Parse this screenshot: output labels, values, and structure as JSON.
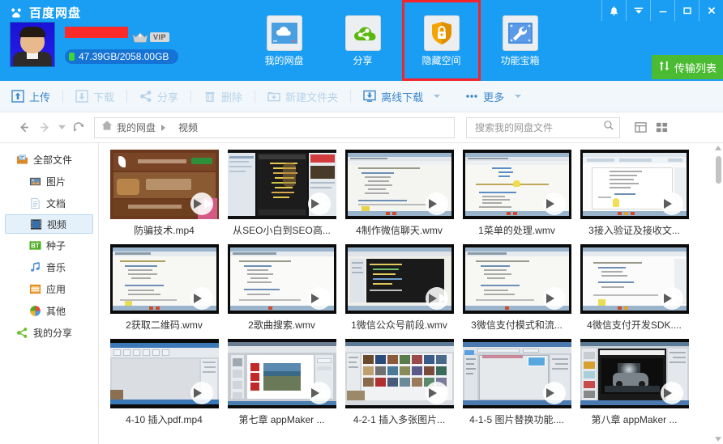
{
  "app": {
    "brand": "百度网盘",
    "brand_icon": "baidu-cloud-logo"
  },
  "user": {
    "name_redacted": true,
    "vip_label": "VIP",
    "quota": "47.39GB/2058.00GB"
  },
  "window_controls": [
    {
      "name": "notifications",
      "icon": "bell-icon"
    },
    {
      "name": "menu",
      "icon": "chevron-down-icon"
    },
    {
      "name": "minimize",
      "icon": "minimize-icon"
    },
    {
      "name": "maximize",
      "icon": "maximize-icon"
    },
    {
      "name": "close",
      "icon": "close-icon"
    }
  ],
  "nav": {
    "items": [
      {
        "label": "我的网盘",
        "icon": "cloud-disk-icon",
        "selected": true,
        "highlighted": false
      },
      {
        "label": "分享",
        "icon": "share-cloud-icon",
        "selected": false,
        "highlighted": false
      },
      {
        "label": "隐藏空间",
        "icon": "lock-shield-icon",
        "selected": false,
        "highlighted": true
      },
      {
        "label": "功能宝箱",
        "icon": "wrench-toolbox-icon",
        "selected": false,
        "highlighted": false
      }
    ]
  },
  "transfer": {
    "label": "传输列表",
    "icon": "transfer-icon",
    "color": "#4cbb34"
  },
  "toolbar": {
    "items": [
      {
        "label": "上传",
        "icon": "upload-icon",
        "disabled": false,
        "caret": false
      },
      {
        "label": "下载",
        "icon": "download-icon",
        "disabled": true,
        "caret": false
      },
      {
        "label": "分享",
        "icon": "share-icon",
        "disabled": true,
        "caret": false
      },
      {
        "label": "删除",
        "icon": "trash-icon",
        "disabled": true,
        "caret": false
      },
      {
        "label": "新建文件夹",
        "icon": "new-folder-icon",
        "disabled": true,
        "caret": false
      },
      {
        "label": "离线下载",
        "icon": "offline-download-icon",
        "disabled": false,
        "caret": true
      },
      {
        "label": "更多",
        "icon": "more-dots-icon",
        "disabled": false,
        "caret": true
      }
    ]
  },
  "navbar": {
    "back_icon": "arrow-left-icon",
    "forward_icon": "arrow-right-icon",
    "history_icon": "chevron-down-icon",
    "refresh_icon": "refresh-icon",
    "home_icon": "home-icon",
    "breadcrumb": [
      "我的网盘",
      "视频"
    ],
    "search_placeholder": "搜索我的网盘文件",
    "search_value": "",
    "search_icon": "search-icon",
    "view_list_icon": "list-view-icon",
    "view_grid_icon": "grid-view-icon"
  },
  "sidebar": {
    "items": [
      {
        "label": "全部文件",
        "icon": "all-files-icon",
        "sub": false,
        "active": false
      },
      {
        "label": "图片",
        "icon": "picture-icon",
        "sub": true,
        "active": false
      },
      {
        "label": "文档",
        "icon": "document-icon",
        "sub": true,
        "active": false
      },
      {
        "label": "视频",
        "icon": "video-icon",
        "sub": true,
        "active": true
      },
      {
        "label": "种子",
        "icon": "bt-seed-icon",
        "sub": true,
        "active": false
      },
      {
        "label": "音乐",
        "icon": "music-icon",
        "sub": true,
        "active": false
      },
      {
        "label": "应用",
        "icon": "application-icon",
        "sub": true,
        "active": false
      },
      {
        "label": "其他",
        "icon": "other-icon",
        "sub": true,
        "active": false
      },
      {
        "label": "我的分享",
        "icon": "my-share-icon",
        "sub": false,
        "active": false
      }
    ]
  },
  "files": [
    {
      "name": "防骗技术.mp4",
      "thumb": "phone-ad-brown"
    },
    {
      "name": "从SEO小白到SEO高...",
      "thumb": "code-editor-dark"
    },
    {
      "name": "4制作微信聊天.wmv",
      "thumb": "code-white-1"
    },
    {
      "name": "1菜单的处理.wmv",
      "thumb": "code-white-2"
    },
    {
      "name": "3接入验证及接收文...",
      "thumb": "word-doc"
    },
    {
      "name": "2获取二维码.wmv",
      "thumb": "code-white-3"
    },
    {
      "name": "2歌曲搜索.wmv",
      "thumb": "code-white-4"
    },
    {
      "name": "1微信公众号前段.wmv",
      "thumb": "editor-dark-2"
    },
    {
      "name": "3微信支付模式和流...",
      "thumb": "code-white-5"
    },
    {
      "name": "4微信支付开发SDK....",
      "thumb": "code-white-6"
    },
    {
      "name": "4-10 插入pdf.mp4",
      "thumb": "app-blank"
    },
    {
      "name": "第七章 appMaker ...",
      "thumb": "app-photo"
    },
    {
      "name": "4-2-1 插入多张图片...",
      "thumb": "app-gallery"
    },
    {
      "name": "4-1-5 图片替换功能....",
      "thumb": "app-blank2"
    },
    {
      "name": "第八章 appMaker ...",
      "thumb": "app-car"
    }
  ],
  "scrollbar": {
    "up_icon": "caret-up-icon",
    "down_icon": "caret-down-icon"
  }
}
